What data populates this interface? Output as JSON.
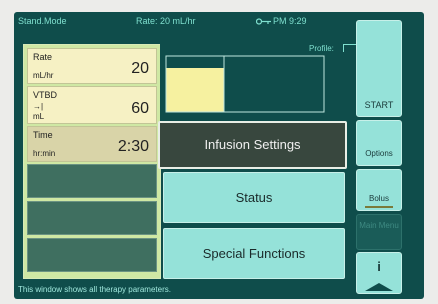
{
  "header": {
    "mode": "Stand.Mode",
    "rate": "Rate: 20 mL/hr",
    "time": "PM 9:29"
  },
  "parameters": [
    {
      "label": "Rate",
      "unit": "mL/hr",
      "value": "20"
    },
    {
      "label": "VTBD",
      "unit": "mL",
      "value": "60"
    },
    {
      "label": "Time",
      "unit": "hr:min",
      "value": "2:30"
    }
  ],
  "chart": {
    "profile_label": "Profile:"
  },
  "chart_data": {
    "type": "bar",
    "values": [
      1
    ],
    "xlim": [
      0,
      1
    ],
    "fill_color": "#f6f1a0"
  },
  "main_buttons": {
    "infusion_settings": "Infusion Settings",
    "status": "Status",
    "special_functions": "Special Functions"
  },
  "side_buttons": {
    "start": "START",
    "options": "Options",
    "bolus": "Bolus",
    "main_menu": "Main Menu",
    "info": "i"
  },
  "status_bar": {
    "message": "This window shows all therapy parameters."
  },
  "colors": {
    "background": "#0f4d4b",
    "accent": "#95e2d9",
    "param": "#f6f1c4"
  }
}
